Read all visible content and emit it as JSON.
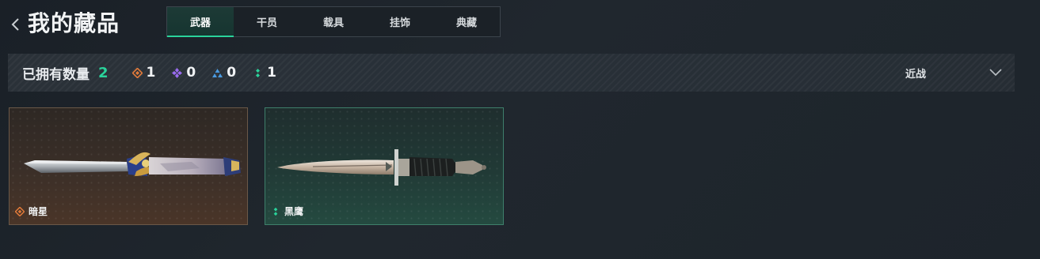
{
  "header": {
    "title": "我的藏品",
    "tabs": [
      {
        "label": "武器",
        "active": true
      },
      {
        "label": "干员",
        "active": false
      },
      {
        "label": "载具",
        "active": false
      },
      {
        "label": "挂饰",
        "active": false
      },
      {
        "label": "典藏",
        "active": false
      }
    ]
  },
  "stats": {
    "owned_label": "已拥有数量",
    "owned_total": "2",
    "rarities": [
      {
        "icon": "orange-diamond-icon",
        "color": "#e07a3a",
        "count": "1"
      },
      {
        "icon": "purple-diamond-icon",
        "color": "#9a6cf0",
        "count": "0"
      },
      {
        "icon": "blue-triangle-icon",
        "color": "#4a9ae0",
        "count": "0"
      },
      {
        "icon": "green-dots-icon",
        "color": "#2ad39b",
        "count": "1"
      }
    ],
    "filter": {
      "selected": "近战"
    }
  },
  "items": [
    {
      "name": "暗星",
      "rarity_icon": "orange-diamond-icon",
      "rarity_color": "#e07a3a"
    },
    {
      "name": "黑鹰",
      "rarity_icon": "green-dots-icon",
      "rarity_color": "#2ad39b"
    }
  ],
  "colors": {
    "accent": "#2ad39b",
    "background": "#1d242b"
  }
}
